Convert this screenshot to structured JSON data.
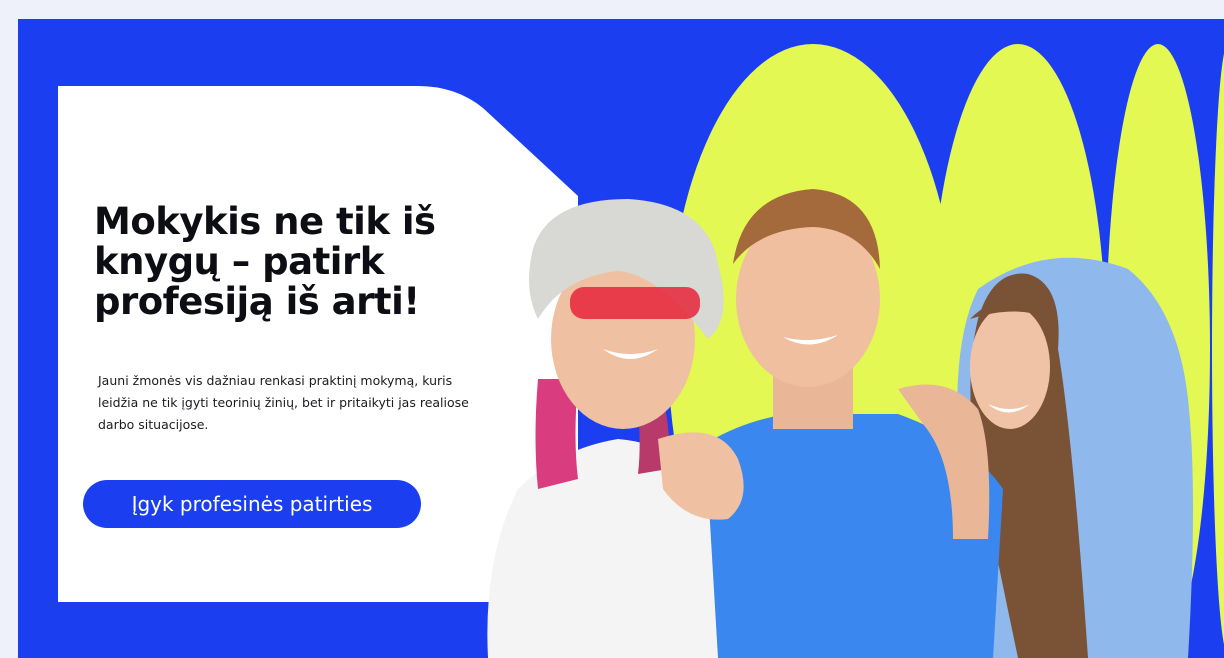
{
  "hero": {
    "headline": "Mokykis ne tik iš knygų – patirk profesiją iš arti!",
    "lead": "Jauni žmonės vis dažniau renkasi praktinį mokymą, kuris leidžia ne tik įgyti teorinių žinių, bet ir pritaikyti jas realiose darbo situacijose.",
    "cta_label": "Įgyk profesinės patirties"
  },
  "colors": {
    "brand_blue": "#1b3ff0",
    "accent_lime": "#e3f852",
    "card_white": "#ffffff",
    "text_dark": "#0d0d14"
  },
  "icons": {
    "photo": "three-teenagers-smiling-photo"
  }
}
